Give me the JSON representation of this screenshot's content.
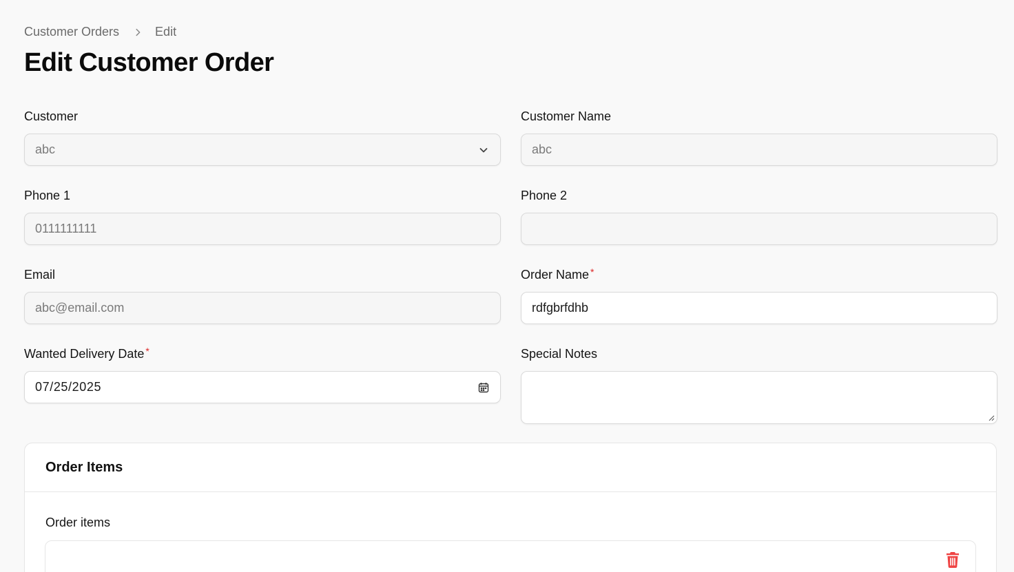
{
  "breadcrumb": {
    "items": [
      "Customer Orders",
      "Edit"
    ]
  },
  "page": {
    "title": "Edit Customer Order"
  },
  "form": {
    "customer": {
      "label": "Customer",
      "value": "abc"
    },
    "customer_name": {
      "label": "Customer Name",
      "value": "abc"
    },
    "phone1": {
      "label": "Phone 1",
      "value": "0111111111"
    },
    "phone2": {
      "label": "Phone 2",
      "value": ""
    },
    "email": {
      "label": "Email",
      "value": "abc@email.com"
    },
    "order_name": {
      "label": "Order Name",
      "value": "rdfgbrfdhb",
      "required_mark": "*"
    },
    "delivery_date": {
      "label": "Wanted Delivery Date",
      "value": "07/25/2025",
      "required_mark": "*"
    },
    "special_notes": {
      "label": "Special Notes",
      "value": ""
    }
  },
  "order_items": {
    "section_title": "Order Items",
    "sub_label": "Order items"
  },
  "icons": {
    "breadcrumb_separator": "chevron-right-icon",
    "select": "chevron-down-icon",
    "date": "calendar-icon",
    "delete": "trash-icon"
  },
  "colors": {
    "required": "#dc2626",
    "delete": "#ef4444"
  }
}
